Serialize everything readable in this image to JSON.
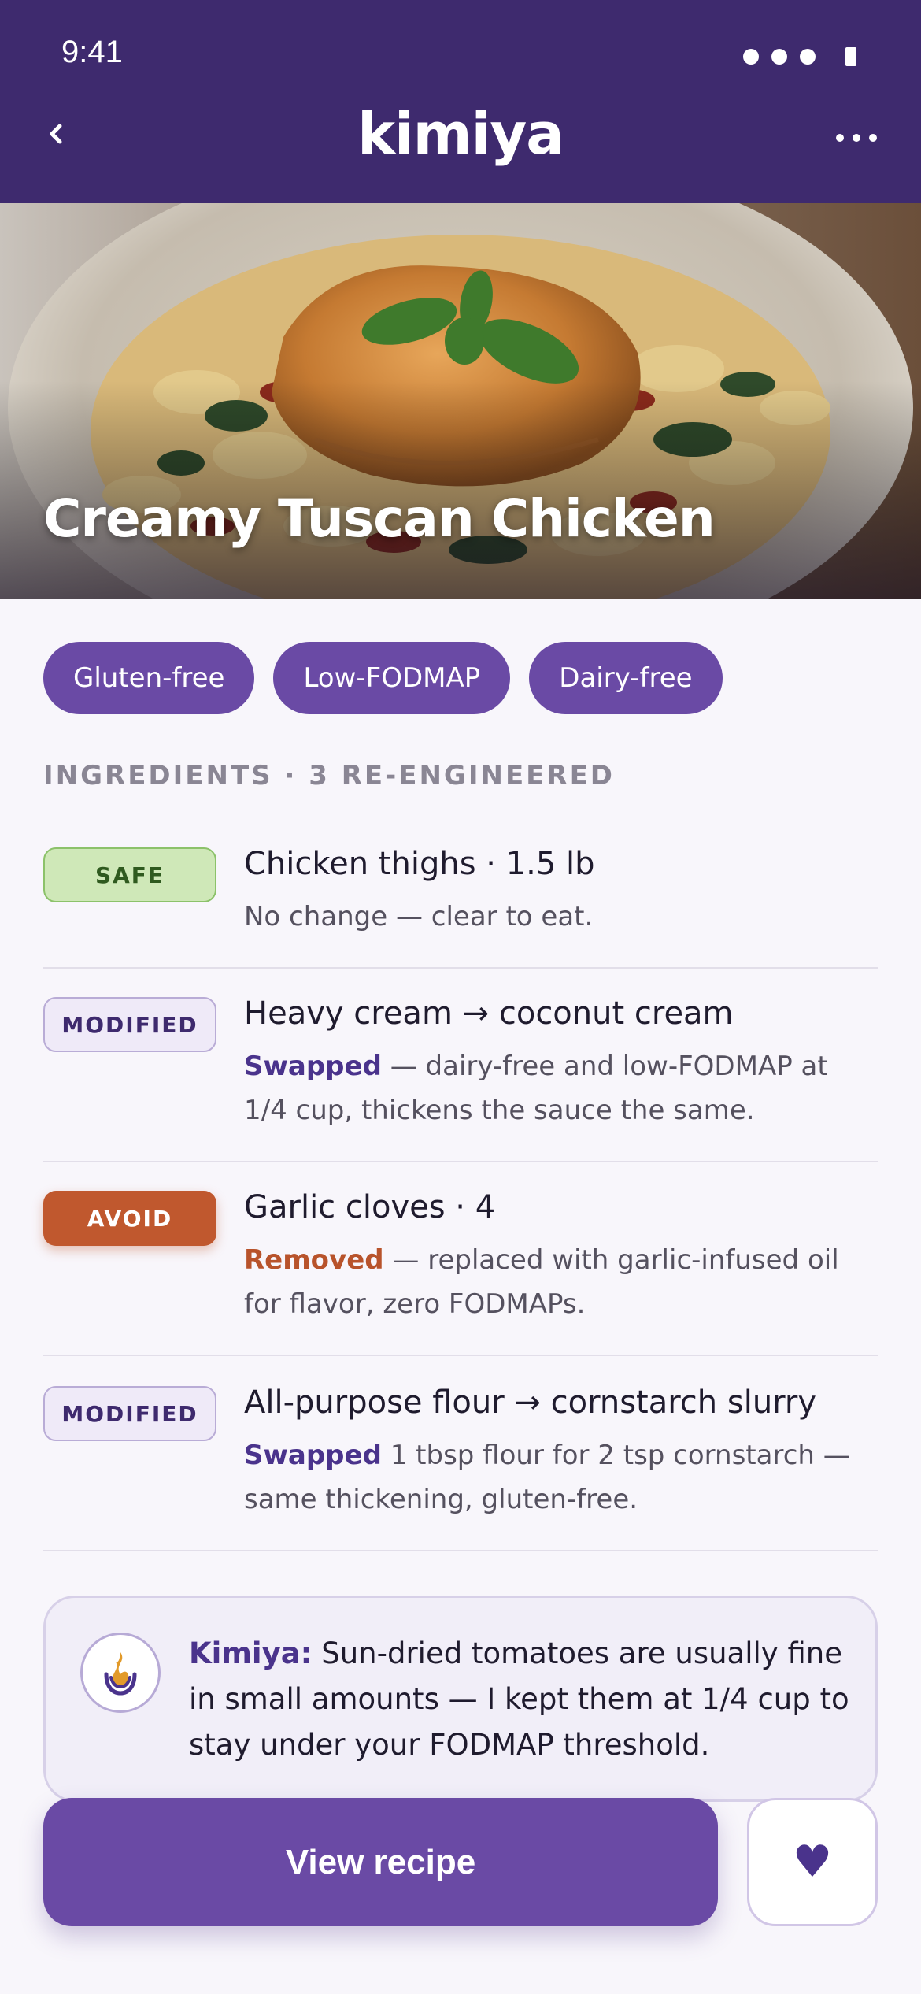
{
  "status_bar": {
    "time": "9:41"
  },
  "header": {
    "brand": "kimiya",
    "back_icon": "chevron-left-icon",
    "more_icon": "more-horizontal-icon",
    "bg": "#3e2a6e"
  },
  "hero": {
    "title": "Creamy Tuscan Chicken"
  },
  "diet_tags": [
    "Gluten-free",
    "Low-FODMAP",
    "Dairy-free"
  ],
  "ingredients_section": {
    "label": "INGREDIENTS · 3 RE-ENGINEERED"
  },
  "ingredients": [
    {
      "status": "SAFE",
      "name": "Chicken thighs · 1.5 lb",
      "note_prefix": "",
      "note": "No change — clear to eat."
    },
    {
      "status": "MODIFIED",
      "name": "Heavy cream → coconut cream",
      "note_prefix": "Swapped",
      "note": " — dairy-free and low-FODMAP at 1/4 cup, thickens the sauce the same."
    },
    {
      "status": "AVOID",
      "name": "Garlic cloves · 4",
      "note_prefix": "Removed",
      "note": " — replaced with garlic-infused oil for flavor, zero FODMAPs."
    },
    {
      "status": "MODIFIED",
      "name": "All-purpose flour → cornstarch slurry",
      "note_prefix": "Swapped",
      "note": " 1 tbsp flour for 2 tsp cornstarch — same thickening, gluten-free."
    }
  ],
  "tip": {
    "who": "Kimiya:",
    "text": " Sun-dried tomatoes are usually fine in small amounts — I kept them at 1/4 cup to stay under your FODMAP threshold.",
    "icon": "flame-icon"
  },
  "actions": {
    "primary": "View recipe",
    "favorite_icon": "heart-icon",
    "favorite_glyph": "♥"
  },
  "colors": {
    "accent": "#6a4aa5",
    "safe": "#cfe8b8",
    "avoid": "#c0582e",
    "modified": "#efeaf8"
  }
}
